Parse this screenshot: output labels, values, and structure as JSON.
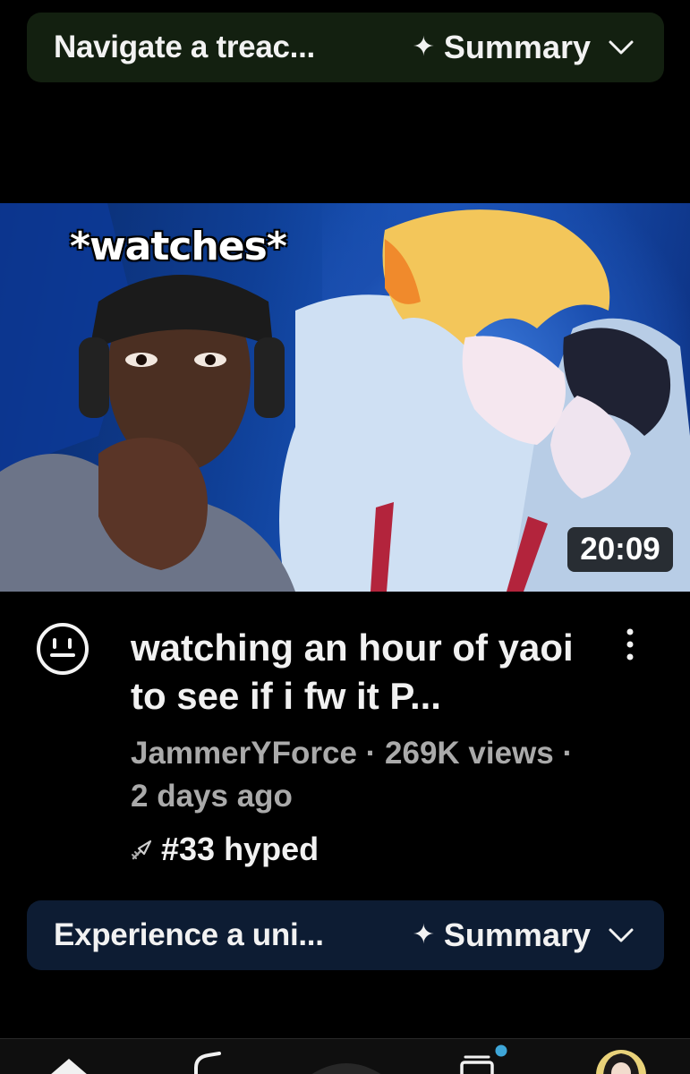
{
  "top_summary": {
    "text": "Navigate a treac...",
    "label": "Summary",
    "sparkle": "✦"
  },
  "video": {
    "thumbnail_caption": "*watches*",
    "duration": "20:09",
    "title": "watching an hour of yaoi to see if i fw it P...",
    "channel": "JammerYForce",
    "separator": " · ",
    "views": "269K views",
    "age": "2 days ago",
    "hype": "#33 hyped"
  },
  "bottom_summary": {
    "text": "Experience a uni...",
    "label": "Summary",
    "sparkle": "✦"
  },
  "bottom_nav": {
    "items": [
      "home-icon",
      "shorts-icon",
      "create-icon",
      "subscriptions-icon",
      "you-avatar"
    ]
  },
  "colors": {
    "top_pill_bg": "#132010",
    "bottom_pill_bg": "#0d1c33",
    "meta_text": "#aaaaaa",
    "text_primary": "#f1f1f1"
  }
}
